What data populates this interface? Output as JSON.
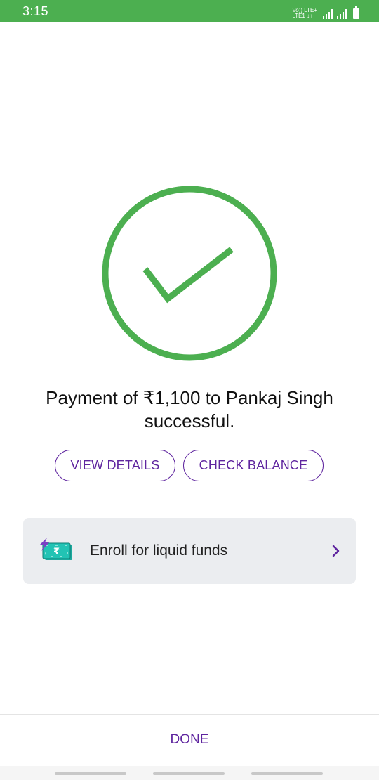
{
  "status_bar": {
    "time": "3:15",
    "network_line1": "Vo)) LTE+",
    "network_line2": "LTE1 ↓↑",
    "icons": [
      "volte-icon",
      "signal-icon",
      "signal-icon",
      "battery-icon"
    ]
  },
  "success": {
    "icon": "check-circle-icon",
    "color": "#4caf50",
    "message": "Payment of ₹1,100 to Pankaj Singh successful."
  },
  "actions": {
    "view_details": "VIEW DETAILS",
    "check_balance": "CHECK BALANCE"
  },
  "promo": {
    "icon": "rupee-note-icon",
    "label": "Enroll for liquid funds",
    "chevron": "chevron-right-icon"
  },
  "footer": {
    "done_label": "DONE"
  },
  "colors": {
    "accent": "#5f259f",
    "status_bar": "#4caf50",
    "card_bg": "#ebedf0"
  }
}
